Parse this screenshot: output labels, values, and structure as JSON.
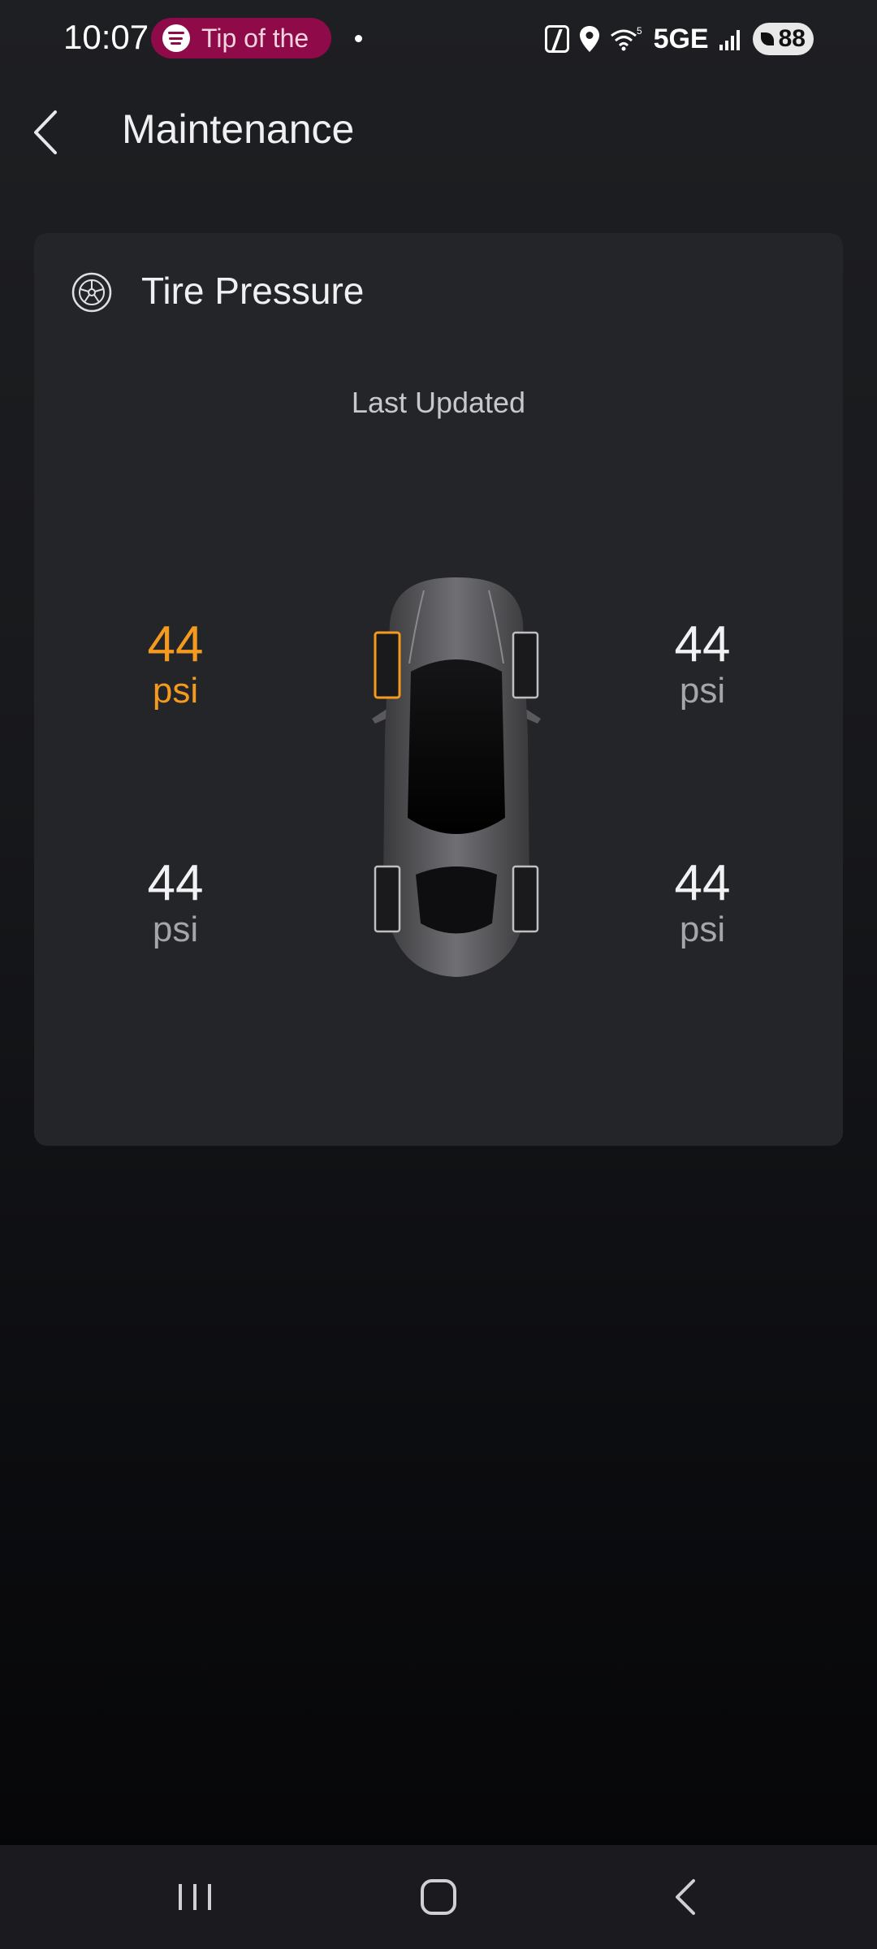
{
  "status_bar": {
    "time": "10:07",
    "media_pill_text": "Tip of the",
    "network": "5GE",
    "battery": "88",
    "media_pill_color": "#8e0a48"
  },
  "header": {
    "title": "Maintenance",
    "back_icon": "chevron-left-icon"
  },
  "tire_card": {
    "title": "Tire Pressure",
    "icon": "tire-icon",
    "last_updated_label": "Last Updated",
    "warning_color": "#f39a1f",
    "readings": {
      "front_left": {
        "value": "44",
        "unit": "psi",
        "status": "warning"
      },
      "front_right": {
        "value": "44",
        "unit": "psi",
        "status": "normal"
      },
      "rear_left": {
        "value": "44",
        "unit": "psi",
        "status": "normal"
      },
      "rear_right": {
        "value": "44",
        "unit": "psi",
        "status": "normal"
      }
    }
  },
  "nav_bar": {
    "icons": [
      "recents-icon",
      "home-icon",
      "back-icon"
    ]
  }
}
